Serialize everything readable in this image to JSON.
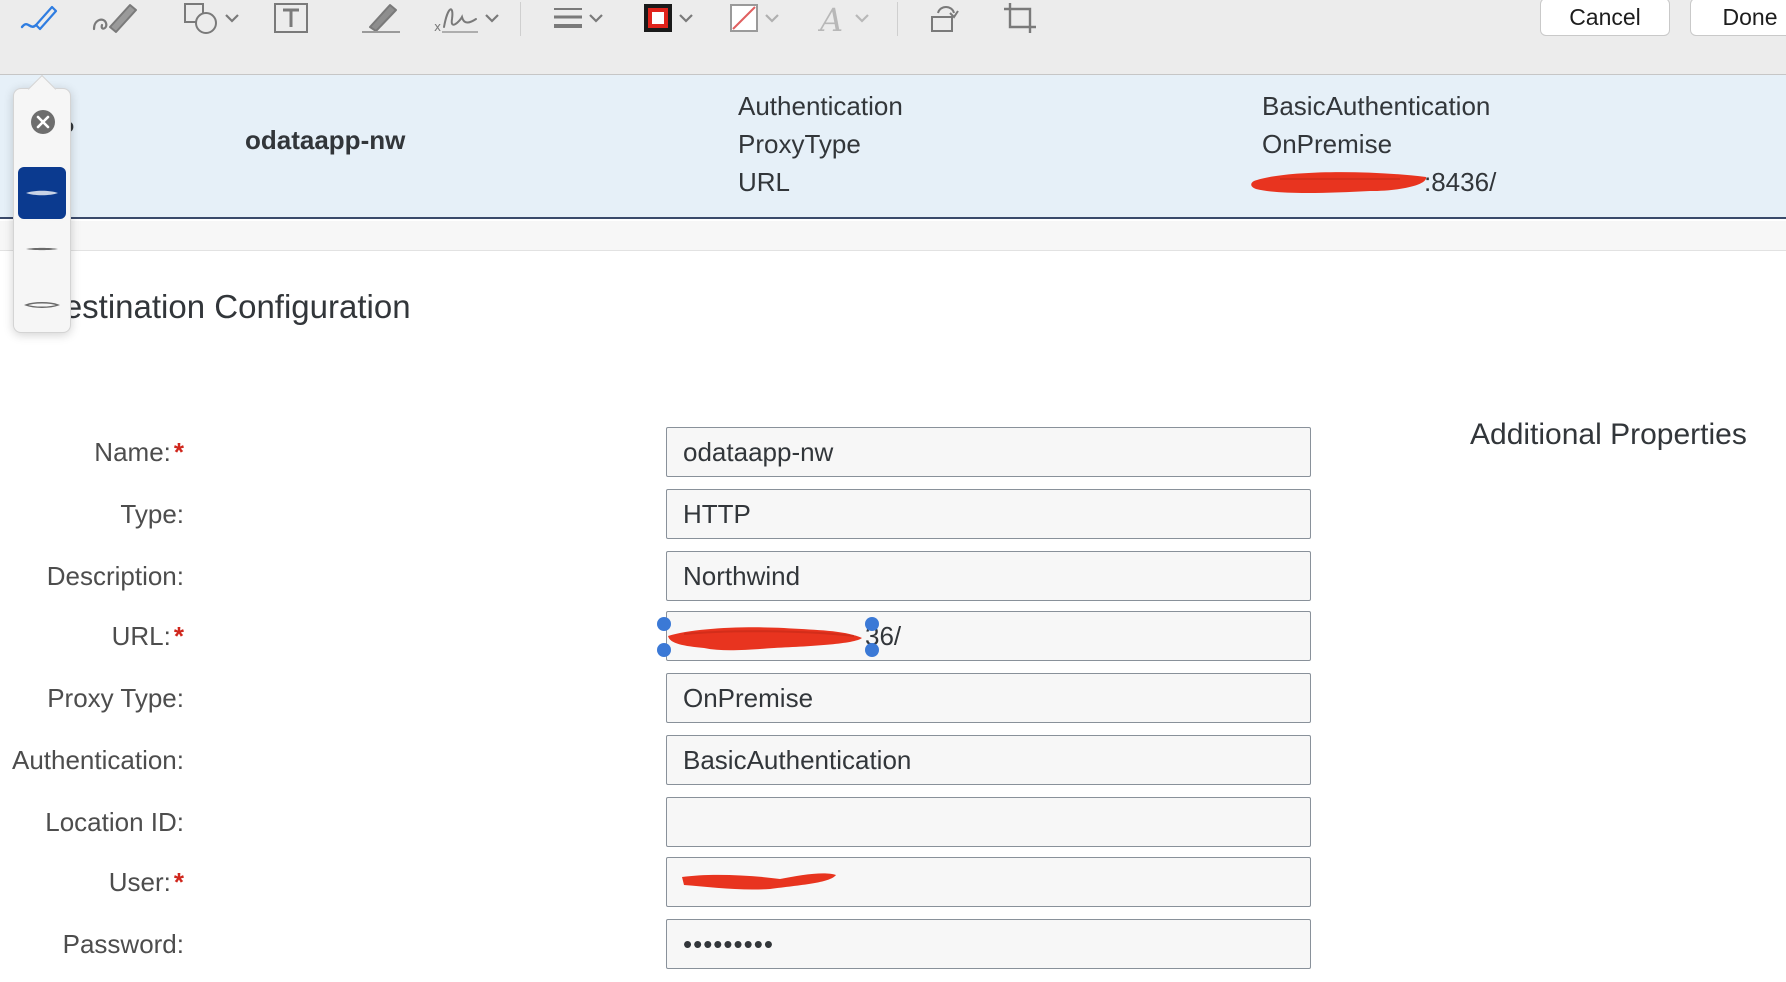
{
  "toolbar": {
    "tools": [
      {
        "name": "sketch-icon"
      },
      {
        "name": "draw-icon"
      },
      {
        "name": "shapes-icon"
      },
      {
        "name": "text-box-icon"
      },
      {
        "name": "highlight-icon"
      },
      {
        "name": "signature-icon"
      },
      {
        "name": "line-style-icon"
      },
      {
        "name": "border-color-icon"
      },
      {
        "name": "fill-color-icon"
      },
      {
        "name": "text-style-icon"
      },
      {
        "name": "rotate-icon"
      },
      {
        "name": "crop-icon"
      }
    ],
    "cancel_label": "Cancel",
    "done_label": "Done",
    "border_color": "#e0231b"
  },
  "stroke_popover": {
    "options": [
      "thick",
      "medium",
      "thin"
    ],
    "selected": "thick",
    "selected_color": "#0b3a8f"
  },
  "destination_header": {
    "row_prefix": "P",
    "name": "odataapp-nw",
    "property_keys": [
      "Authentication",
      "ProxyType",
      "URL"
    ],
    "property_values": [
      "BasicAuthentication",
      "OnPremise",
      ":8436/"
    ]
  },
  "section_title": "Destination Configuration",
  "additional_properties_title": "Additional Properties",
  "form": {
    "name": {
      "label": "Name:",
      "required": true,
      "value": "odataapp-nw"
    },
    "type": {
      "label": "Type:",
      "required": false,
      "value": "HTTP"
    },
    "description": {
      "label": "Description:",
      "required": false,
      "value": "Northwind"
    },
    "url": {
      "label": "URL:",
      "required": true,
      "value": "36/"
    },
    "proxy_type": {
      "label": "Proxy Type:",
      "required": false,
      "value": "OnPremise"
    },
    "authentication": {
      "label": "Authentication:",
      "required": false,
      "value": "BasicAuthentication"
    },
    "location_id": {
      "label": "Location ID:",
      "required": false,
      "value": ""
    },
    "user": {
      "label": "User:",
      "required": true,
      "value": ""
    },
    "password": {
      "label": "Password:",
      "required": false,
      "value": "•••••••••"
    }
  },
  "redaction_color": "#e8341f",
  "required_marker": "*"
}
